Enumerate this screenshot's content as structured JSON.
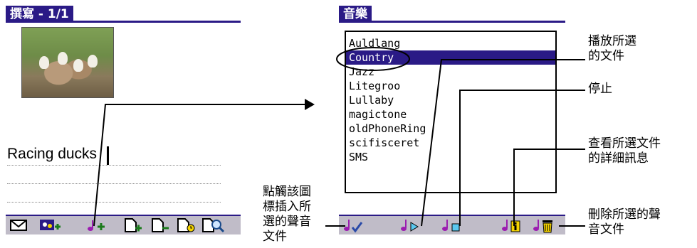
{
  "left_screen": {
    "title": "撰寫 - 1/1",
    "note_text": "Racing ducks",
    "toolbar": [
      "envelope-icon",
      "photo-add-icon",
      "sound-add-icon",
      "page-add-icon",
      "page-remove-icon",
      "page-clock-icon",
      "find-page-icon"
    ]
  },
  "right_screen": {
    "title": "音樂",
    "songs": [
      "Auldlang",
      "Country",
      "Jazz",
      "Litegroo",
      "Lullaby",
      "magictone",
      "oldPhoneRing",
      "scifisceret",
      "SMS"
    ],
    "selected_song": "Country",
    "toolbar": [
      "sound-check-icon",
      "sound-play-icon",
      "sound-stop-icon",
      "sound-info-icon",
      "sound-delete-icon"
    ]
  },
  "callouts": {
    "play": "播放所選\n的文件",
    "stop": "停止",
    "details": "查看所選文件\n的詳細訊息",
    "delete": "刪除所選的聲\n音文件",
    "insert": "點觸該圖\n標插入所\n選的聲音\n文件"
  },
  "colors": {
    "accent": "#2a1a86",
    "toolbar": "#c0bcc8",
    "sound_icon": "#9b1cb0",
    "highlight": "#f5d400"
  }
}
